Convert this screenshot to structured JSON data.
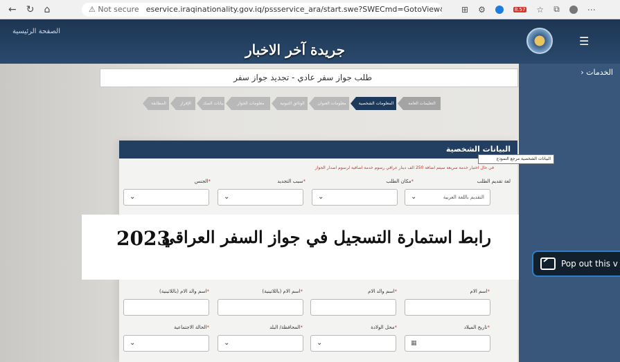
{
  "browser": {
    "security_label": "Not secure",
    "url": "eservice.iraqinationality.gov.iq/pssservice_ara/start.swe?SWECmd=GotoView&SWEView=O...",
    "ext_badge": "8.57"
  },
  "header": {
    "home_link": "الصفحة الرئيسية",
    "brand_banner": "جريدة آخر الاخبار",
    "menu_icon": "hamburger-icon"
  },
  "sidebar": {
    "services_label": "› الخدمات"
  },
  "main": {
    "service_title": "طلب جواز سفر عادي - تجديد جواز سفر",
    "steps": [
      {
        "label": "التعليمات العامة",
        "state": "done"
      },
      {
        "label": "المعلومات الشخصية",
        "state": "active"
      },
      {
        "label": "معلومات العنوان",
        "state": "pending"
      },
      {
        "label": "الوثائق الثبوتية",
        "state": "pending"
      },
      {
        "label": "معلومات الجواز السابق",
        "state": "pending"
      },
      {
        "label": "بيانات الصك",
        "state": "pending"
      },
      {
        "label": "الإقرار",
        "state": "pending"
      },
      {
        "label": "المطابقة",
        "state": "pending"
      }
    ]
  },
  "form": {
    "section_title": "البيانات الشخصية",
    "tooltip": "البيانات الشخصية مرجع النموذج",
    "warning": "في حال اختيار خدمة سريعة سيتم اضافة 250 الف دينار عراقي رسوم خدمة اضافية لرسوم اصدار الجواز",
    "row1": {
      "language_label": "لغة تقديم الطلب",
      "language_value": "التقديم باللغة العربية",
      "place_label": "مكان الطلب",
      "reason_label": "سبب التجديد",
      "gender_label": "الجنس"
    },
    "row3": {
      "mother_label": "اسم الام",
      "mother_father_label": "اسم والد الام",
      "mother_latin_label": "اسم الام (باللاتينية)",
      "mother_father_latin_label": "اسم والد الام (باللاتينية)"
    },
    "row4": {
      "birth_date_label": "تاريخ الميلاد",
      "birth_place_label": "محل الولادة",
      "province_label": "المحافظة/ البلد",
      "marital_label": "الحالة الاجتماعية"
    },
    "required_mark": "*"
  },
  "overlay": {
    "headline": "رابط استمارة التسجيل في جواز السفر العراقي",
    "year": "2023",
    "popout_label": "Pop out this v"
  }
}
